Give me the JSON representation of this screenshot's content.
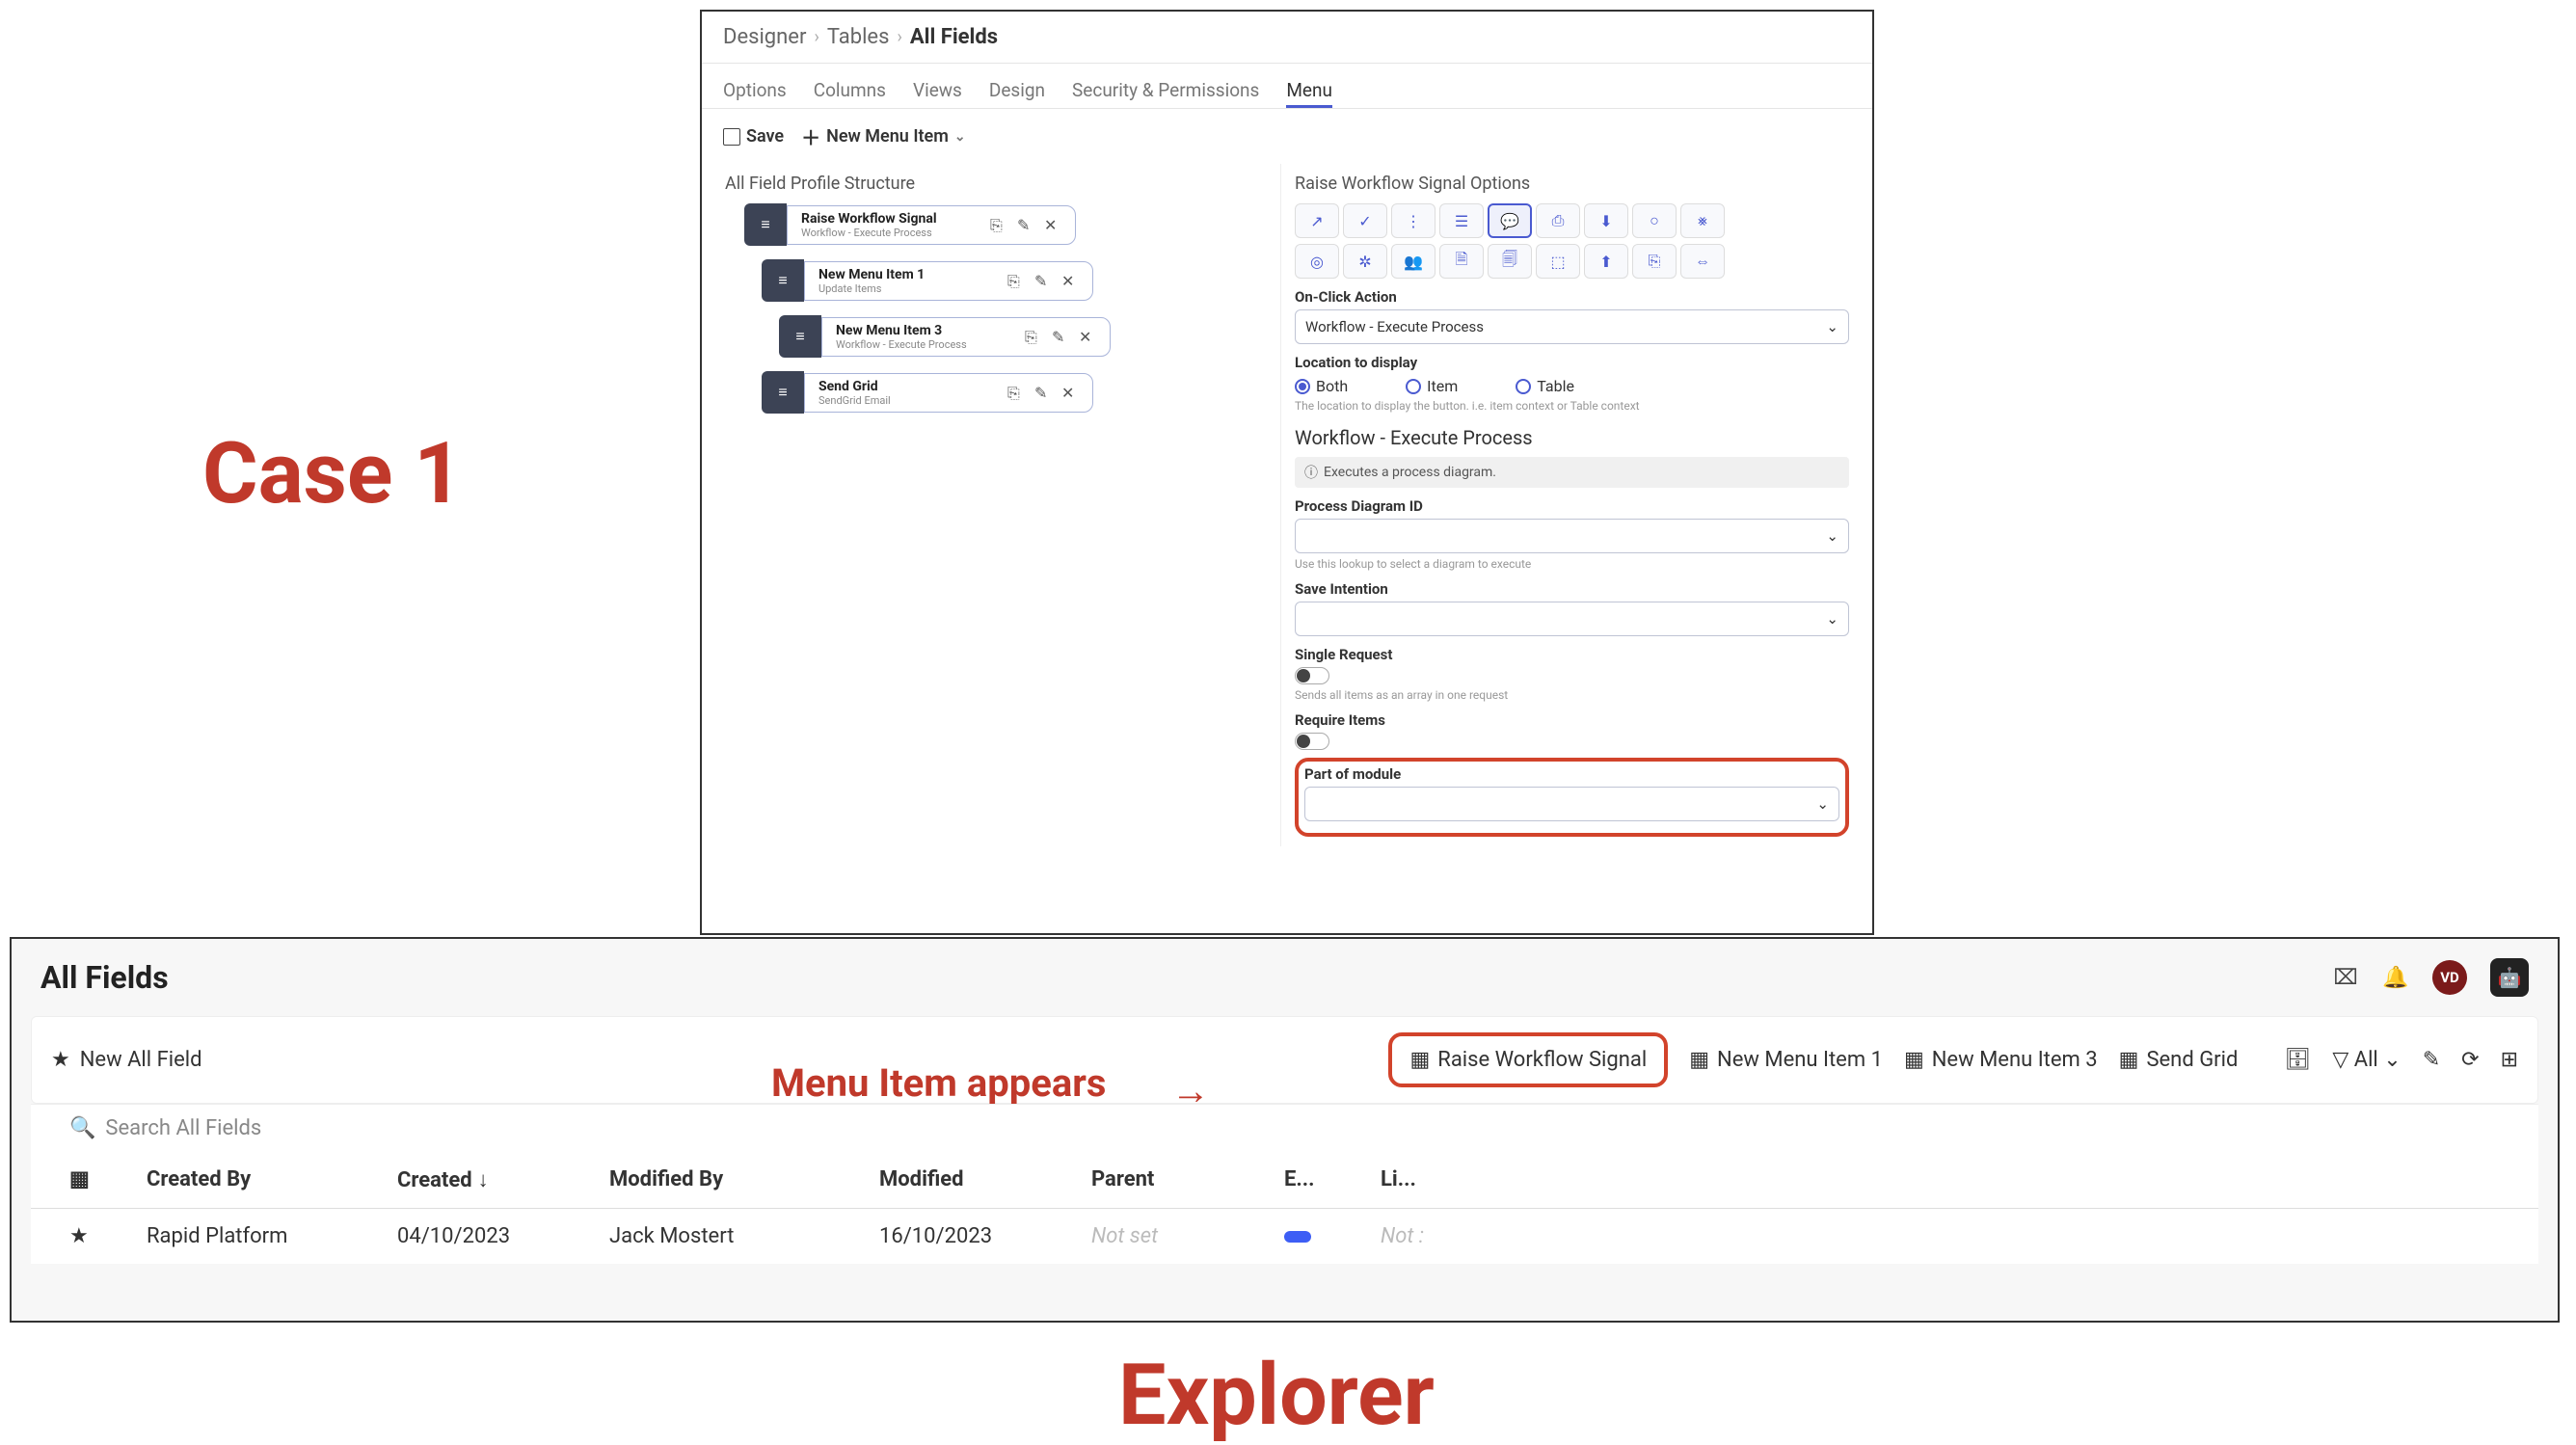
{
  "annotations": {
    "case": "Case 1",
    "menu_appears": "Menu Item appears",
    "explorer": "Explorer"
  },
  "designer": {
    "breadcrumb": [
      "Designer",
      "Tables",
      "All Fields"
    ],
    "tabs": [
      "Options",
      "Columns",
      "Views",
      "Design",
      "Security & Permissions",
      "Menu"
    ],
    "active_tab": "Menu",
    "toolbar": {
      "save": "Save",
      "new_item": "New Menu Item"
    },
    "left": {
      "title": "All Field Profile Structure",
      "items": [
        {
          "title": "Raise Workflow Signal",
          "sub": "Workflow - Execute Process"
        },
        {
          "title": "New Menu Item 1",
          "sub": "Update Items"
        },
        {
          "title": "New Menu Item 3",
          "sub": "Workflow - Execute Process"
        },
        {
          "title": "Send Grid",
          "sub": "SendGrid Email"
        }
      ]
    },
    "right": {
      "title": "Raise Workflow Signal Options",
      "onclick_label": "On-Click Action",
      "onclick_value": "Workflow - Execute Process",
      "location_label": "Location to display",
      "location_options": [
        "Both",
        "Item",
        "Table"
      ],
      "location_selected": "Both",
      "location_hint": "The location to display the button. i.e. item context or Table context",
      "workflow_heading": "Workflow - Execute Process",
      "info": "Executes a process diagram.",
      "process_id_label": "Process Diagram ID",
      "process_id_hint": "Use this lookup to select a diagram to execute",
      "save_intention_label": "Save Intention",
      "single_request_label": "Single Request",
      "single_request_hint": "Sends all items as an array in one request",
      "require_items_label": "Require Items",
      "part_of_module_label": "Part of module"
    }
  },
  "explorer": {
    "title": "All Fields",
    "avatar": "VD",
    "new_btn": "New All Field",
    "search_placeholder": "Search All Fields",
    "menu_buttons": [
      "Raise Workflow Signal",
      "New Menu Item 1",
      "New Menu Item 3",
      "Send Grid"
    ],
    "filter_label": "All",
    "columns": [
      "Created By",
      "Created",
      "Modified By",
      "Modified",
      "Parent",
      "E...",
      "Li..."
    ],
    "row": {
      "created_by": "Rapid Platform",
      "created": "04/10/2023",
      "modified_by": "Jack Mostert",
      "modified": "16/10/2023",
      "parent": "Not set",
      "li": "Not :"
    }
  }
}
